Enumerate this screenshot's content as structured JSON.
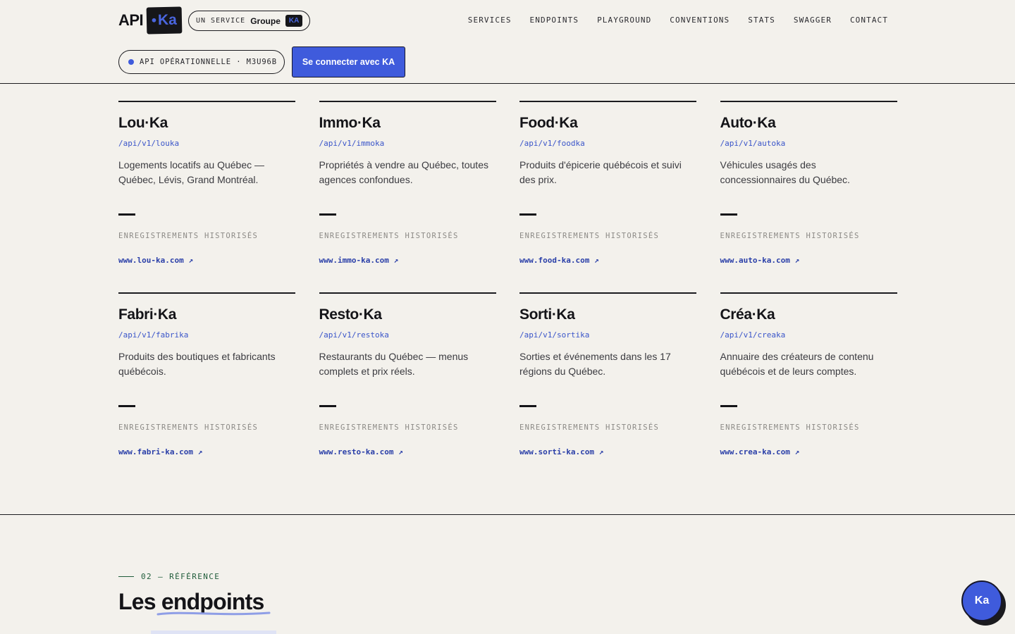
{
  "header": {
    "logo": {
      "api": "API",
      "dot": "•",
      "ka": "Ka"
    },
    "service_pill": {
      "prefix": "UN SERVICE",
      "groupe": "Groupe",
      "badge": "KA"
    },
    "nav": [
      "SERVICES",
      "ENDPOINTS",
      "PLAYGROUND",
      "CONVENTIONS",
      "STATS",
      "SWAGGER",
      "CONTACT"
    ],
    "status": "API OPÉRATIONNELLE · M3U96B",
    "login_button": "Se connecter avec KA"
  },
  "services": [
    {
      "name": "Lou·Ka",
      "path": "/api/v1/louka",
      "description": "Logements locatifs au Québec — Québec, Lévis, Grand Montréal.",
      "count": "—",
      "count_label": "ENREGISTREMENTS HISTORISÉS",
      "link": "www.lou-ka.com ↗"
    },
    {
      "name": "Immo·Ka",
      "path": "/api/v1/immoka",
      "description": "Propriétés à vendre au Québec, toutes agences confondues.",
      "count": "—",
      "count_label": "ENREGISTREMENTS HISTORISÉS",
      "link": "www.immo-ka.com ↗"
    },
    {
      "name": "Food·Ka",
      "path": "/api/v1/foodka",
      "description": "Produits d'épicerie québécois et suivi des prix.",
      "count": "—",
      "count_label": "ENREGISTREMENTS HISTORISÉS",
      "link": "www.food-ka.com ↗"
    },
    {
      "name": "Auto·Ka",
      "path": "/api/v1/autoka",
      "description": "Véhicules usagés des concessionnaires du Québec.",
      "count": "—",
      "count_label": "ENREGISTREMENTS HISTORISÉS",
      "link": "www.auto-ka.com ↗"
    },
    {
      "name": "Fabri·Ka",
      "path": "/api/v1/fabrika",
      "description": "Produits des boutiques et fabricants québécois.",
      "count": "—",
      "count_label": "ENREGISTREMENTS HISTORISÉS",
      "link": "www.fabri-ka.com ↗"
    },
    {
      "name": "Resto·Ka",
      "path": "/api/v1/restoka",
      "description": "Restaurants du Québec — menus complets et prix réels.",
      "count": "—",
      "count_label": "ENREGISTREMENTS HISTORISÉS",
      "link": "www.resto-ka.com ↗"
    },
    {
      "name": "Sorti·Ka",
      "path": "/api/v1/sortika",
      "description": "Sorties et événements dans les 17 régions du Québec.",
      "count": "—",
      "count_label": "ENREGISTREMENTS HISTORISÉS",
      "link": "www.sorti-ka.com ↗"
    },
    {
      "name": "Créa·Ka",
      "path": "/api/v1/creaka",
      "description": "Annuaire des créateurs de contenu québécois et de leurs comptes.",
      "count": "—",
      "count_label": "ENREGISTREMENTS HISTORISÉS",
      "link": "www.crea-ka.com ↗"
    }
  ],
  "reference": {
    "eyebrow": "02 — RÉFÉRENCE",
    "title_plain": "Les",
    "title_underlined": "endpoints"
  },
  "fab": {
    "label": "Ka"
  },
  "colors": {
    "background": "#f3f1ec",
    "accent": "#3f5bdc",
    "ink": "#16161a",
    "section_green": "#1f5c3a"
  }
}
